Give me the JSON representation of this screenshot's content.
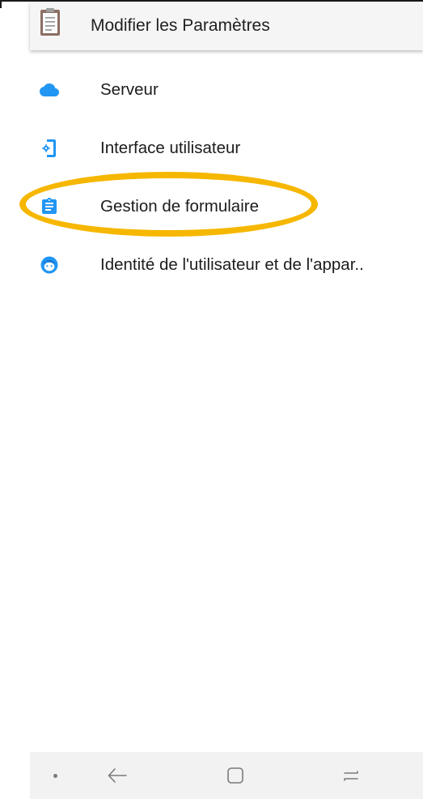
{
  "toolbar": {
    "title": "Modifier les Paramètres",
    "icon": "clipboard-icon"
  },
  "settings_items": [
    {
      "label": "Serveur",
      "icon": "cloud-icon",
      "icon_color": "#2196f3"
    },
    {
      "label": "Interface utilisateur",
      "icon": "phone-settings-icon",
      "icon_color": "#2196f3"
    },
    {
      "label": "Gestion de formulaire",
      "icon": "form-clipboard-icon",
      "icon_color": "#2196f3"
    },
    {
      "label": "Identité de l'utilisateur et de l'appar..",
      "icon": "face-icon",
      "icon_color": "#2196f3"
    }
  ],
  "highlight": {
    "target": "Gestion de formulaire",
    "color": "#f6b700"
  },
  "navbar": {
    "items": [
      "dot-icon",
      "back-arrow-icon",
      "home-square-icon",
      "recent-apps-icon"
    ]
  },
  "colors": {
    "accent": "#2196f3",
    "toolbar_bg": "#f5f5f5",
    "navbar_bg": "#f2f2f2"
  }
}
